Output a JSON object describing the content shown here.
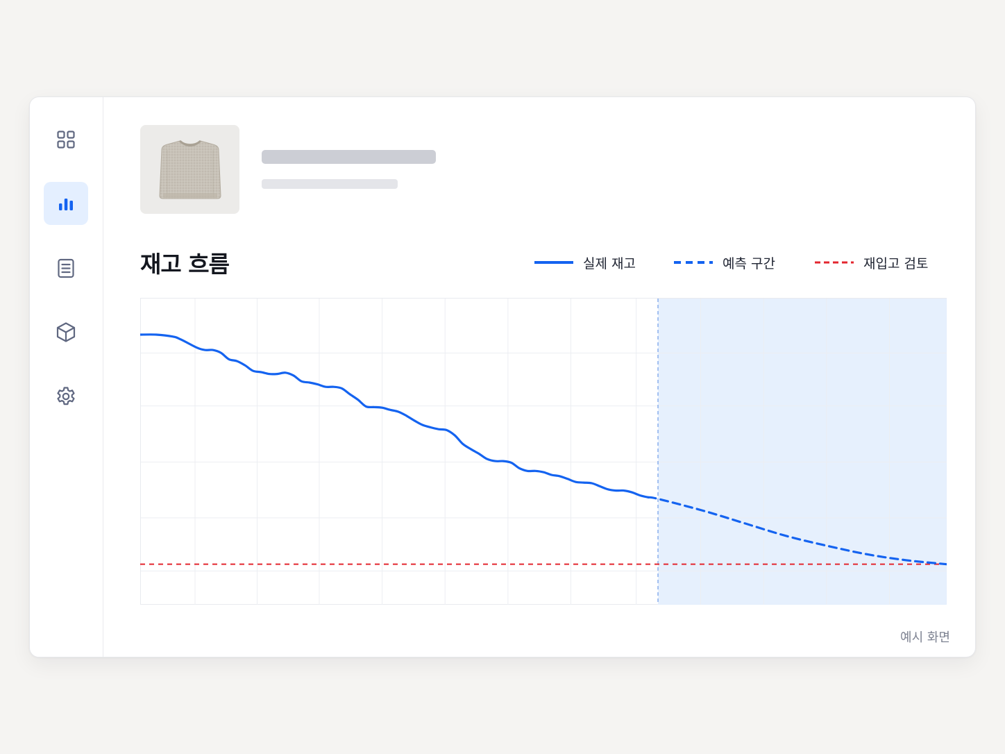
{
  "sidebar": {
    "items": [
      {
        "icon": "grid-icon",
        "name": "dashboard",
        "active": false
      },
      {
        "icon": "bar-chart-icon",
        "name": "analytics",
        "active": true
      },
      {
        "icon": "document-icon",
        "name": "reports",
        "active": false
      },
      {
        "icon": "box-icon",
        "name": "inventory",
        "active": false
      },
      {
        "icon": "gear-icon",
        "name": "settings",
        "active": false
      }
    ]
  },
  "product": {
    "image": "sweater-image"
  },
  "section": {
    "title": "재고 흐름"
  },
  "legend": {
    "actual": "실제 재고",
    "forecast": "예측 구간",
    "reorder": "재입고 검토"
  },
  "footnote": "예시 화면",
  "colors": {
    "actual": "#1463f0",
    "forecast": "#1463f0",
    "forecast_band": "#e3eefd",
    "reorder": "#e3262f",
    "active_nav": "#e4efff"
  },
  "chart_data": {
    "type": "line",
    "xlim": [
      0,
      100
    ],
    "ylim": [
      0,
      100
    ],
    "grid": true,
    "forecast_start_x": 64.2,
    "series": [
      {
        "key": "actual",
        "style": "solid",
        "points": [
          [
            0,
            88
          ],
          [
            2,
            88
          ],
          [
            4,
            87.4
          ],
          [
            5,
            86.5
          ],
          [
            7,
            83.8
          ],
          [
            8,
            83
          ],
          [
            9,
            83
          ],
          [
            10,
            82.1
          ],
          [
            11,
            80
          ],
          [
            12,
            79.4
          ],
          [
            13,
            78
          ],
          [
            14,
            76.2
          ],
          [
            15,
            75.8
          ],
          [
            16,
            75.2
          ],
          [
            17,
            75.2
          ],
          [
            18,
            75.6
          ],
          [
            19,
            74.7
          ],
          [
            20,
            72.8
          ],
          [
            21,
            72.4
          ],
          [
            22,
            71.8
          ],
          [
            23,
            71
          ],
          [
            24,
            71
          ],
          [
            25,
            70.5
          ],
          [
            26,
            68.6
          ],
          [
            27,
            66.8
          ],
          [
            28,
            64.6
          ],
          [
            29,
            64.4
          ],
          [
            30,
            64.2
          ],
          [
            31,
            63.5
          ],
          [
            32,
            62.9
          ],
          [
            33,
            61.6
          ],
          [
            34,
            60
          ],
          [
            35,
            58.6
          ],
          [
            36,
            57.8
          ],
          [
            37,
            57.2
          ],
          [
            38,
            56.9
          ],
          [
            39,
            55.2
          ],
          [
            40,
            52.4
          ],
          [
            41,
            50.7
          ],
          [
            42,
            49.2
          ],
          [
            43,
            47.5
          ],
          [
            44,
            46.8
          ],
          [
            45,
            46.8
          ],
          [
            46,
            46.3
          ],
          [
            47,
            44.5
          ],
          [
            48,
            43.6
          ],
          [
            49,
            43.6
          ],
          [
            50,
            43.2
          ],
          [
            51,
            42.3
          ],
          [
            52,
            41.9
          ],
          [
            53,
            41
          ],
          [
            54,
            40
          ],
          [
            55,
            39.8
          ],
          [
            56,
            39.6
          ],
          [
            57,
            38.6
          ],
          [
            58,
            37.6
          ],
          [
            59,
            37.2
          ],
          [
            60,
            37.2
          ],
          [
            61,
            36.6
          ],
          [
            62,
            35.6
          ],
          [
            63,
            35
          ]
        ]
      },
      {
        "key": "forecast",
        "style": "dashed",
        "points": [
          [
            63,
            35
          ],
          [
            64.2,
            34.5
          ],
          [
            70,
            30.5
          ],
          [
            75,
            26.5
          ],
          [
            80,
            22.5
          ],
          [
            85,
            19.3
          ],
          [
            90,
            16.5
          ],
          [
            95,
            14.5
          ],
          [
            100,
            13.2
          ]
        ]
      },
      {
        "key": "reorder",
        "style": "dashed",
        "constant": 13.2
      }
    ]
  }
}
